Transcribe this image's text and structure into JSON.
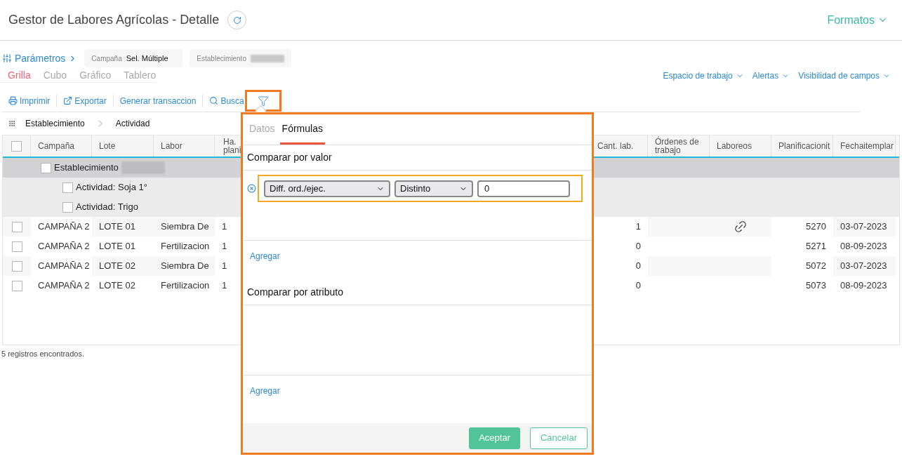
{
  "header": {
    "title": "Gestor de Labores Agrícolas - Detalle",
    "formats_menu": "Formatos"
  },
  "parameters": {
    "label": "Parámetros",
    "fields": [
      {
        "label": "Campaña",
        "value": "Sel. Múltiple"
      },
      {
        "label": "Establecimiento"
      }
    ]
  },
  "view_tabs": [
    {
      "label": "Grilla",
      "selected": true
    },
    {
      "label": "Cubo",
      "selected": false
    },
    {
      "label": "Gráfico",
      "selected": false
    },
    {
      "label": "Tablero",
      "selected": false
    }
  ],
  "top_links": [
    "Espacio de trabajo",
    "Alertas",
    "Visibilidad de campos"
  ],
  "toolbar": [
    {
      "label": "Imprimir",
      "kind": "print"
    },
    {
      "label": "Exportar",
      "kind": "export"
    },
    {
      "label": "Generar transaccion",
      "kind": "plain"
    },
    {
      "label": "Busca",
      "kind": "search"
    }
  ],
  "filter_button": {
    "highlighted": true
  },
  "grouping": [
    "Establecimiento",
    "Actividad"
  ],
  "table": {
    "columns": [
      "Campaña",
      "Lote",
      "Labor",
      "Ha. plani",
      "Cant. lab.",
      "Órdenes de trabajo",
      "Laboreos",
      "Planificacionit",
      "Fechaitemplar"
    ],
    "header_checked": false,
    "groups": [
      {
        "label": "Establecimiento",
        "checked": false,
        "children": [
          {
            "label": "Actividad: Soja 1°",
            "checked": false
          },
          {
            "label": "Actividad: Trigo",
            "checked": false
          }
        ]
      }
    ],
    "rows": [
      {
        "checked": false,
        "cells": [
          "CAMPAÑA 2",
          "LOTE 01",
          "Siembra De",
          "1",
          "1",
          "",
          "",
          "5270",
          "03-07-2023"
        ],
        "link": true
      },
      {
        "checked": false,
        "cells": [
          "CAMPAÑA 2",
          "LOTE 01",
          "Fertilizacion",
          "1",
          "0",
          "",
          "",
          "5271",
          "08-09-2023"
        ],
        "link": false
      },
      {
        "checked": false,
        "cells": [
          "CAMPAÑA 2",
          "LOTE 02",
          "Siembra De",
          "1",
          "0",
          "",
          "",
          "5072",
          "03-07-2023"
        ],
        "link": false
      },
      {
        "checked": false,
        "cells": [
          "CAMPAÑA 2",
          "LOTE 02",
          "Fertilizacion",
          "1",
          "0",
          "",
          "",
          "5073",
          "08-09-2023"
        ],
        "link": false
      }
    ]
  },
  "status": "5 registros encontrados.",
  "filter_popup": {
    "highlighted": true,
    "tabs": [
      {
        "label": "Datos",
        "selected": false
      },
      {
        "label": "Fórmulas",
        "selected": true
      }
    ],
    "sections": [
      {
        "title": "Comparar por valor",
        "add_label": "Agregar",
        "conditions": [
          {
            "field": "Diff. ord./ejec.",
            "operator": "Distinto",
            "value": "0",
            "highlighted": true
          }
        ]
      },
      {
        "title": "Comparar por atributo",
        "add_label": "Agregar"
      }
    ],
    "buttons": [
      {
        "label": "Aceptar",
        "kind": "primary"
      },
      {
        "label": "Cancelar",
        "kind": "secondary"
      }
    ]
  }
}
